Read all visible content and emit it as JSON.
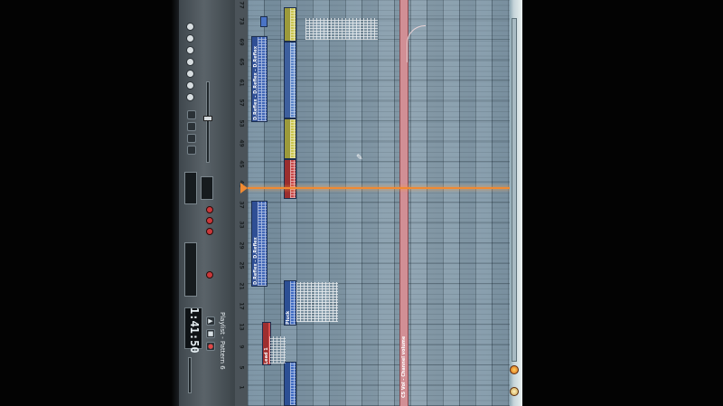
{
  "window": {
    "title": "Playlist - Pattern 6",
    "clock": "1:41:50"
  },
  "ruler": {
    "bars": [
      "1",
      "5",
      "9",
      "13",
      "17",
      "21",
      "25",
      "29",
      "33",
      "37",
      "41",
      "45",
      "49",
      "53",
      "57",
      "61",
      "65",
      "69",
      "73",
      "77"
    ]
  },
  "tracks": {
    "clip_labels": {
      "reflex_main": "D.Reflex - D.Reflex - D.Reflex",
      "reflex_lower": "D.Reflex - D.Reflex",
      "lead_a": "Lead 1",
      "lead_b": "Pluck",
      "automation": "C5 Vol - Channel volume"
    }
  },
  "colors": {
    "accent_playhead": "#f08a32",
    "clip_blue": "#3f6bc2",
    "clip_yellow": "#c8c84a",
    "clip_red": "#d24a4a",
    "automation_pink": "#d18f95",
    "grid": "#7891a2"
  },
  "icons": {
    "tools": [
      "help-icon",
      "draw-icon",
      "paint-icon",
      "delete-icon",
      "mute-icon",
      "slice-icon",
      "select-icon",
      "zoom-icon",
      "playback-icon",
      "snap-icon"
    ],
    "transport": [
      "play-icon",
      "stop-icon",
      "record-icon"
    ]
  }
}
